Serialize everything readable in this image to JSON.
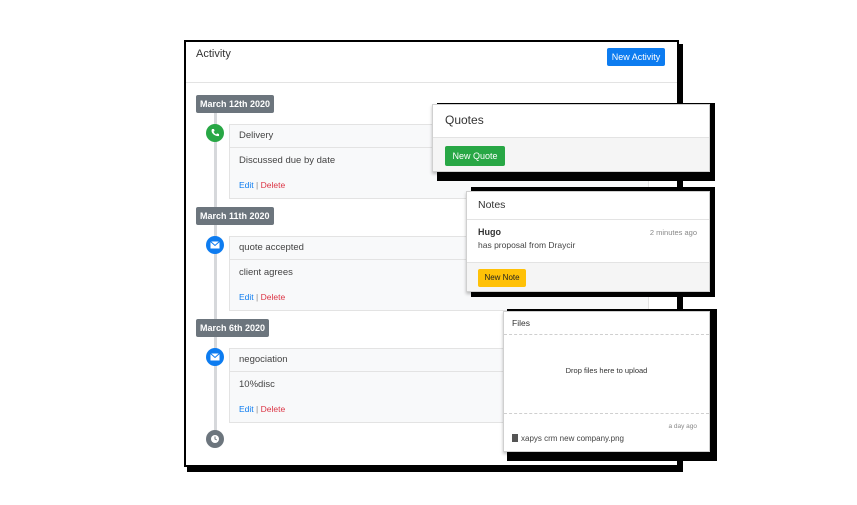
{
  "activity": {
    "title": "Activity",
    "new_button": "New Activity",
    "groups": [
      {
        "date": "March 12th 2020",
        "icon": "phone-icon",
        "title": "Delivery",
        "body": "Discussed due by date",
        "edit": "Edit",
        "sep": "|",
        "delete": "Delete"
      },
      {
        "date": "March 11th 2020",
        "icon": "envelope-icon",
        "title": "quote accepted",
        "body": "client agrees",
        "edit": "Edit",
        "sep": "|",
        "delete": "Delete"
      },
      {
        "date": "March 6th 2020",
        "icon": "envelope-icon",
        "title": "negociation",
        "body": "10%disc",
        "edit": "Edit",
        "sep": "|",
        "delete": "Delete"
      }
    ],
    "end_icon": "clock-icon"
  },
  "quotes": {
    "title": "Quotes",
    "button": "New Quote"
  },
  "notes": {
    "title": "Notes",
    "author": "Hugo",
    "time": "2 minutes ago",
    "text": "has proposal from Draycir",
    "button": "New Note"
  },
  "files": {
    "title": "Files",
    "dropzone": "Drop files here to upload",
    "file_time": "a day ago",
    "file_name": "xapys crm new company.png",
    "file_icon": "file-icon"
  },
  "colors": {
    "primary": "#0d7cf0",
    "success": "#28a745",
    "warning": "#ffc107",
    "danger": "#dc3545",
    "secondary": "#6c757d"
  }
}
